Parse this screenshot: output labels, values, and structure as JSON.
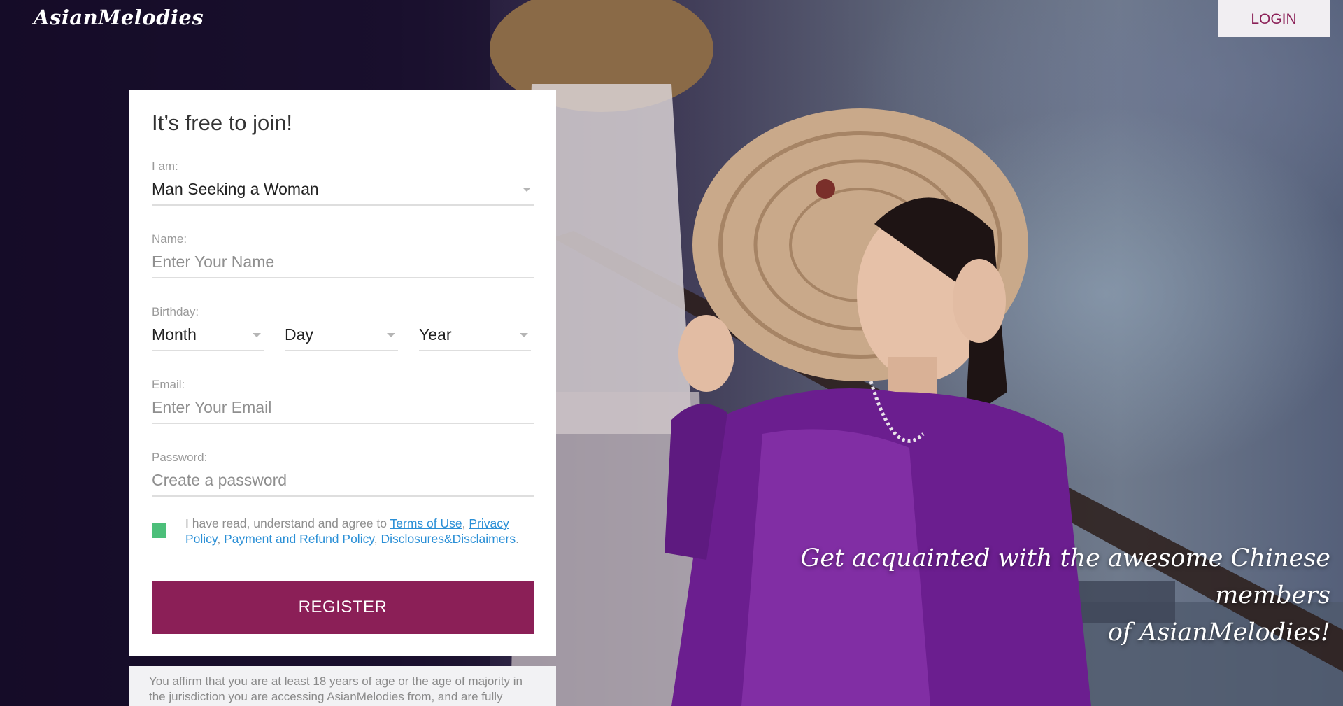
{
  "header": {
    "logo_text": "AsianMelodies",
    "login_label": "LOGIN"
  },
  "form": {
    "title": "It’s free to join!",
    "iam": {
      "label": "I am:",
      "value": "Man Seeking a Woman"
    },
    "name": {
      "label": "Name:",
      "placeholder": "Enter Your Name"
    },
    "birthday": {
      "label": "Birthday:",
      "month": "Month",
      "day": "Day",
      "year": "Year"
    },
    "email": {
      "label": "Email:",
      "placeholder": "Enter Your Email"
    },
    "password": {
      "label": "Password:",
      "placeholder": "Create a password"
    },
    "agree": {
      "checked": true,
      "prefix": "I have read, understand and agree to",
      "terms": "Terms of Use",
      "privacy": "Privacy Policy",
      "refund": "Payment and Refund Policy",
      "disclosures": "Disclosures&Disclaimers"
    },
    "register_label": "REGISTER"
  },
  "disclaimer": "You affirm that you are at least 18 years of age or the age of majority in the jurisdiction you are accessing AsianMelodies from, and are fully",
  "tagline": {
    "line1": "Get acquainted with the awesome Chinese members",
    "line2": "of AsianMelodies!"
  },
  "colors": {
    "brand": "#8b1f57",
    "checkbox": "#4cbf7a",
    "link": "#2a8fd6"
  }
}
